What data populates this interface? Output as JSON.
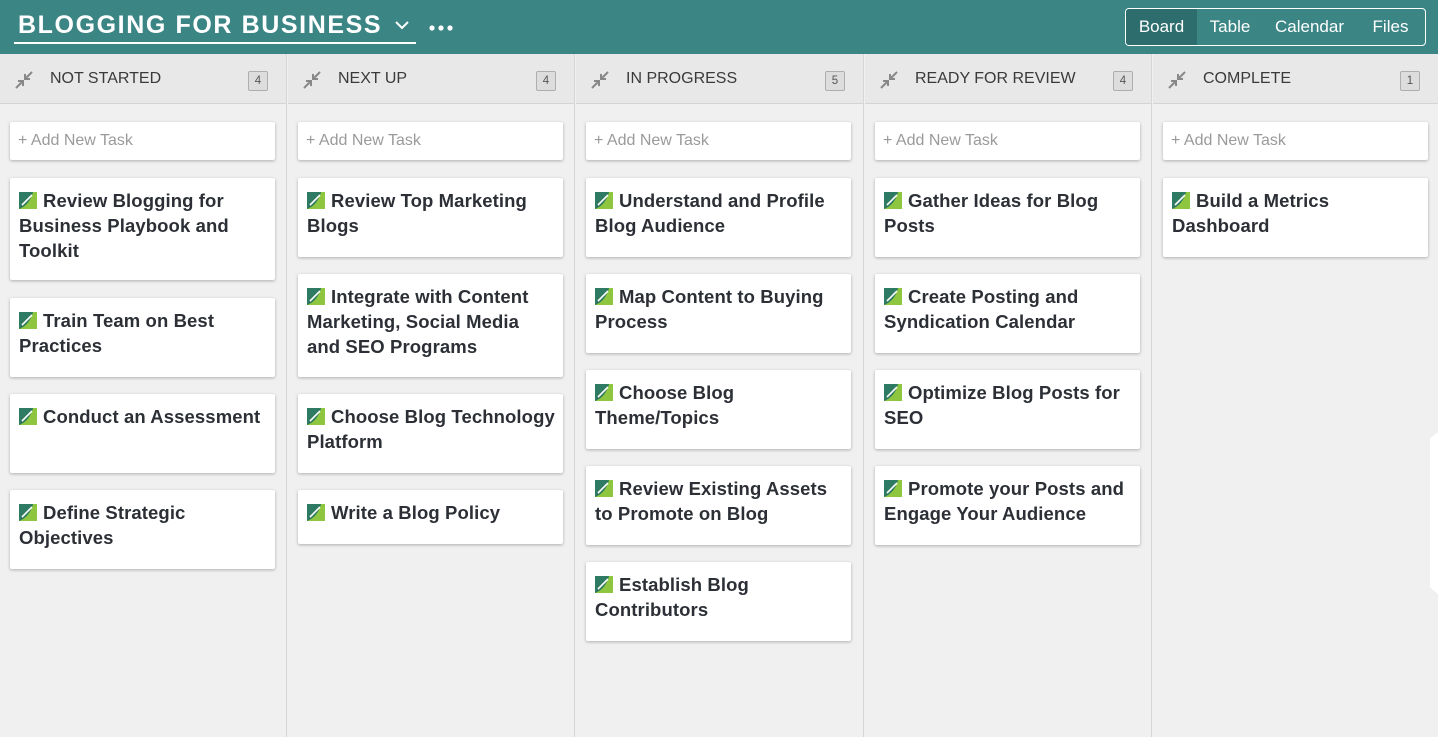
{
  "header": {
    "project_title": "BLOGGING FOR BUSINESS",
    "background_color": "#3b8585",
    "chevron_icon": "chevron-down-icon",
    "more_icon": "ellipsis-icon",
    "views": [
      {
        "label": "Board",
        "active": true
      },
      {
        "label": "Table",
        "active": false
      },
      {
        "label": "Calendar",
        "active": false
      },
      {
        "label": "Files",
        "active": false
      }
    ]
  },
  "board": {
    "add_task_label": "+ Add New Task",
    "collapse_icon": "collapse-arrows-icon",
    "task_icon": "task-status-icon",
    "columns": [
      {
        "title": "NOT STARTED",
        "count": "4",
        "cards": [
          {
            "title": "Review Blogging for Business Playbook and Toolkit"
          },
          {
            "title": "Train Team on Best Practices"
          },
          {
            "title": "Conduct an Assessment"
          },
          {
            "title": "Define Strategic Objectives"
          }
        ]
      },
      {
        "title": "NEXT UP",
        "count": "4",
        "cards": [
          {
            "title": "Review Top Marketing Blogs"
          },
          {
            "title": "Integrate with Content Marketing, Social Media and SEO Programs"
          },
          {
            "title": "Choose Blog Technology Platform"
          },
          {
            "title": "Write a Blog Policy"
          }
        ]
      },
      {
        "title": "IN PROGRESS",
        "count": "5",
        "cards": [
          {
            "title": "Understand and Profile Blog Audience"
          },
          {
            "title": "Map Content to Buying Process"
          },
          {
            "title": "Choose Blog Theme/Topics"
          },
          {
            "title": "Review Existing Assets to Promote on Blog"
          },
          {
            "title": "Establish Blog Contributors"
          }
        ]
      },
      {
        "title": "READY FOR REVIEW",
        "count": "4",
        "cards": [
          {
            "title": "Gather Ideas for Blog Posts"
          },
          {
            "title": "Create Posting and Syndication Calendar"
          },
          {
            "title": "Optimize Blog Posts for SEO"
          },
          {
            "title": "Promote your Posts and Engage Your Audience"
          }
        ]
      },
      {
        "title": "COMPLETE",
        "count": "1",
        "cards": [
          {
            "title": "Build a Metrics Dashboard"
          }
        ]
      }
    ]
  }
}
